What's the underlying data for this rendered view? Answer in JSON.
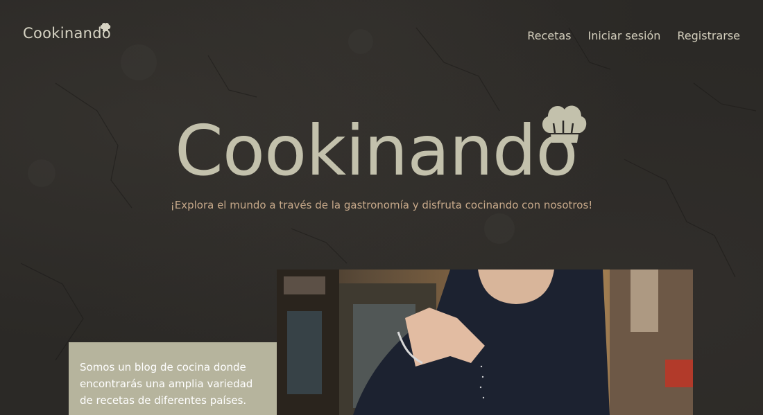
{
  "brand": {
    "name": "Cookinando",
    "hat_icon": "chef-hat-icon"
  },
  "nav": {
    "items": [
      "Recetas",
      "Iniciar sesión",
      "Registrarse"
    ]
  },
  "hero": {
    "title": "Cookinando",
    "tagline": "¡Explora el mundo a través de la gastronomía y disfruta cocinando con nosotros!"
  },
  "about": {
    "text": "Somos un blog de cocina donde encontrarás una amplia variedad de recetas de diferentes países."
  },
  "colors": {
    "background": "#2b2926",
    "brand_text": "#c3c1ac",
    "tagline": "#c7a98a",
    "about_box": "#b6b49d"
  }
}
